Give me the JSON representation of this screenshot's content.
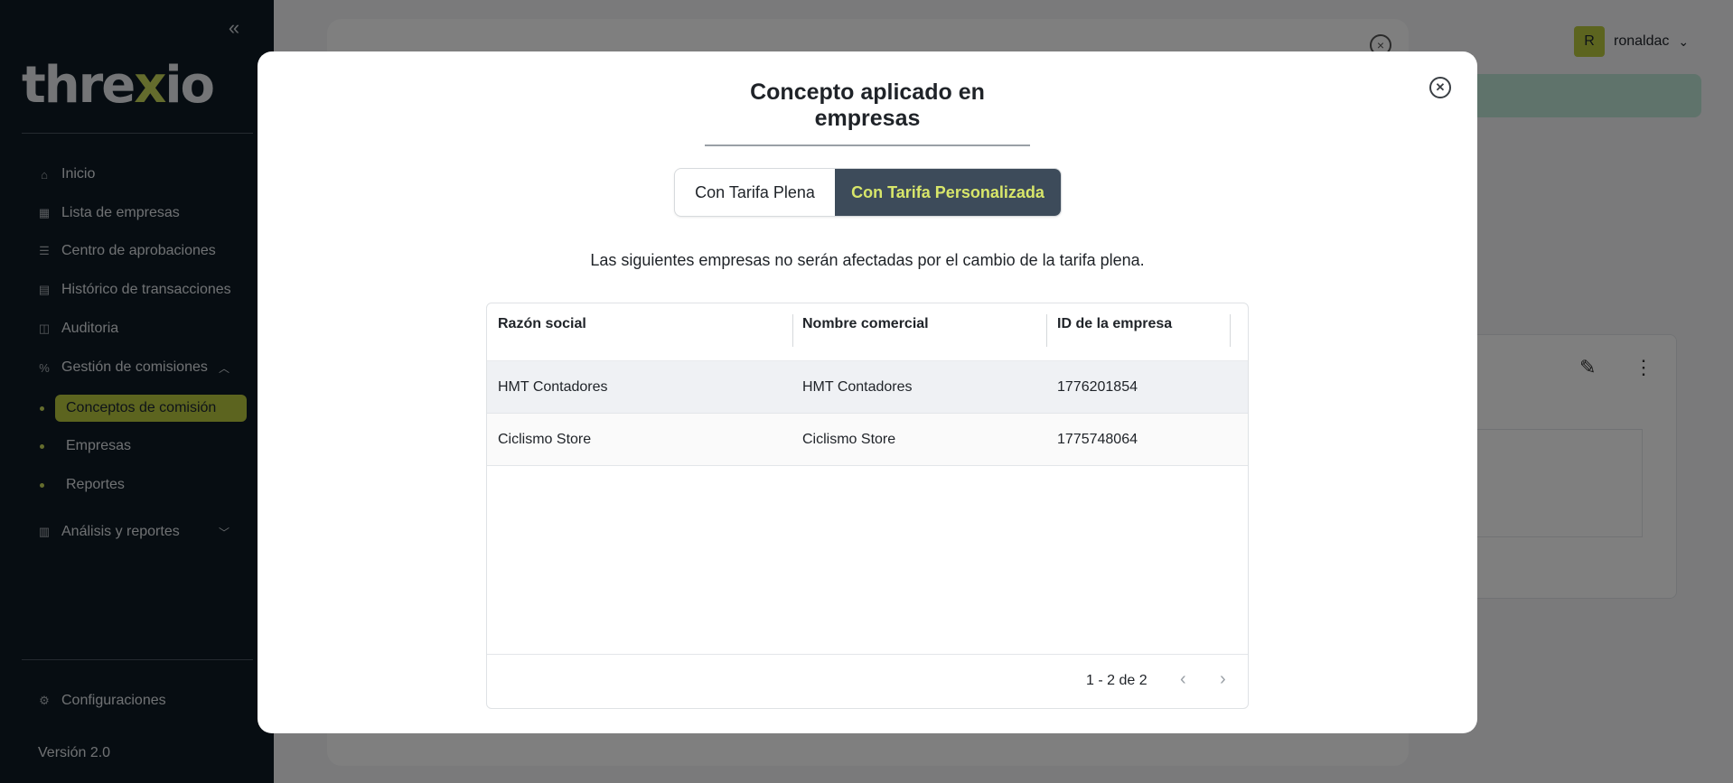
{
  "sidebar": {
    "collapse_icon": "double-chevron-left-icon",
    "logo": {
      "text": "threxio"
    },
    "items": [
      {
        "label": "Inicio",
        "icon": "home-icon"
      },
      {
        "label": "Lista de empresas",
        "icon": "building-icon"
      },
      {
        "label": "Centro de aprobaciones",
        "icon": "checklist-icon"
      },
      {
        "label": "Histórico de transacciones",
        "icon": "document-icon"
      },
      {
        "label": "Auditoria",
        "icon": "audit-icon"
      },
      {
        "label": "Gestión de comisiones",
        "icon": "percent-icon"
      }
    ],
    "subitems": [
      {
        "label": "Conceptos de comisión",
        "active": true
      },
      {
        "label": "Empresas",
        "active": false
      },
      {
        "label": "Reportes",
        "active": false
      }
    ],
    "analysis": {
      "label": "Análisis y reportes",
      "icon": "bar-chart-icon"
    },
    "settings": {
      "label": "Configuraciones",
      "icon": "gear-icon"
    },
    "version": "Versión 2.0"
  },
  "header": {
    "avatar_initial": "R",
    "username": "ronaldac"
  },
  "modal": {
    "title": "Concepto aplicado en empresas",
    "tabs": [
      {
        "label": "Con Tarifa Plena",
        "active": false
      },
      {
        "label": "Con Tarifa Personalizada",
        "active": true
      }
    ],
    "notice": "Las siguientes empresas no serán afectadas por el cambio de la tarifa plena.",
    "table": {
      "columns": [
        "Razón social",
        "Nombre comercial",
        "ID de la empresa"
      ],
      "rows": [
        [
          "HMT Contadores",
          "HMT Contadores",
          "1776201854"
        ],
        [
          "Ciclismo Store",
          "Ciclismo Store",
          "1775748064"
        ]
      ]
    },
    "pagination": {
      "text": "1 - 2 de 2"
    }
  },
  "colors": {
    "sidebar_bg": "#0e1a24",
    "accent": "#b9c83e",
    "active_tab_bg": "#3d4b5a",
    "active_tab_text": "#d8e66a"
  }
}
